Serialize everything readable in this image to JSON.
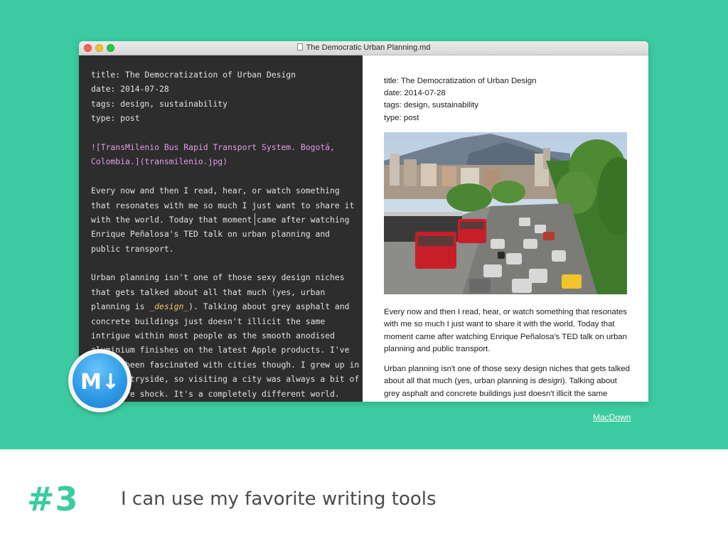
{
  "window": {
    "title": "The Democratic Urban Planning.md"
  },
  "editor": {
    "lines": [
      {
        "text": "title: The Democratization of Urban Design",
        "type": "plain"
      },
      {
        "text": "date: 2014-07-28",
        "type": "plain"
      },
      {
        "text": "tags: design, sustainability",
        "type": "plain"
      },
      {
        "text": "type: post",
        "type": "plain"
      },
      {
        "text": "",
        "type": "plain"
      },
      {
        "text": "![TransMilenio Bus Rapid Transport System. Bogotá,",
        "type": "image"
      },
      {
        "text": "Colombia.](transmilenio.jpg)",
        "type": "image"
      },
      {
        "text": "",
        "type": "plain"
      },
      {
        "text": "Every now and then I read, hear, or watch something",
        "type": "plain"
      },
      {
        "text": "that resonates with me so much I just want to share it",
        "type": "plain"
      },
      {
        "text": "with the world. Today that moment came after watching",
        "type": "plain"
      },
      {
        "text": "Enrique Peñalosa's TED talk on urban planning and",
        "type": "plain"
      },
      {
        "text": "public transport.",
        "type": "plain"
      },
      {
        "text": "",
        "type": "plain"
      },
      {
        "text": "Urban planning isn't one of those sexy design niches",
        "type": "plain"
      },
      {
        "text": "that gets talked about all that much (yes, urban",
        "type": "plain"
      },
      {
        "text": "planning is |_design_|). Talking about grey asphalt and",
        "type": "emph"
      },
      {
        "text": "concrete buildings just doesn't illicit the same",
        "type": "plain"
      },
      {
        "text": "intrigue within most people as the smooth anodised",
        "type": "plain"
      },
      {
        "text": "aluminium finishes on the latest Apple products. I've",
        "type": "plain"
      },
      {
        "text": "always been fascinated with cities though. I grew up in",
        "type": "plain"
      },
      {
        "text": "the countryside, so visiting a city was always a bit of",
        "type": "plain"
      },
      {
        "text": "a culture shock. It's a completely different world.",
        "type": "plain"
      }
    ]
  },
  "preview": {
    "meta": [
      "title: The Democratization of Urban Design",
      "date: 2014-07-28",
      "tags: design, sustainability",
      "type: post"
    ],
    "paragraph1": "Every now and then I read, hear, or watch something that resonates with me so much I just want to share it with the world. Today that moment came after watching Enrique Peñalosa's TED talk on urban planning and public transport.",
    "paragraph2_before": "Urban planning isn't one of those sexy design niches that gets talked about all that much (yes, urban planning is ",
    "paragraph2_emph": "design",
    "paragraph2_after": "). Talking about grey asphalt and concrete buildings just doesn't illicit the same intrigue"
  },
  "app_icon": {
    "name": "markdown-icon",
    "label": "M↓"
  },
  "credit": {
    "label": "MacDown"
  },
  "slide": {
    "number": "#3",
    "caption": "I can use my favorite writing tools"
  },
  "colors": {
    "accent": "#3ccba0",
    "editor_bg": "#2d2d2d",
    "editor_text": "#e2e2e2",
    "link_text": "#e49ae8",
    "emph_text": "#f6c36a"
  }
}
